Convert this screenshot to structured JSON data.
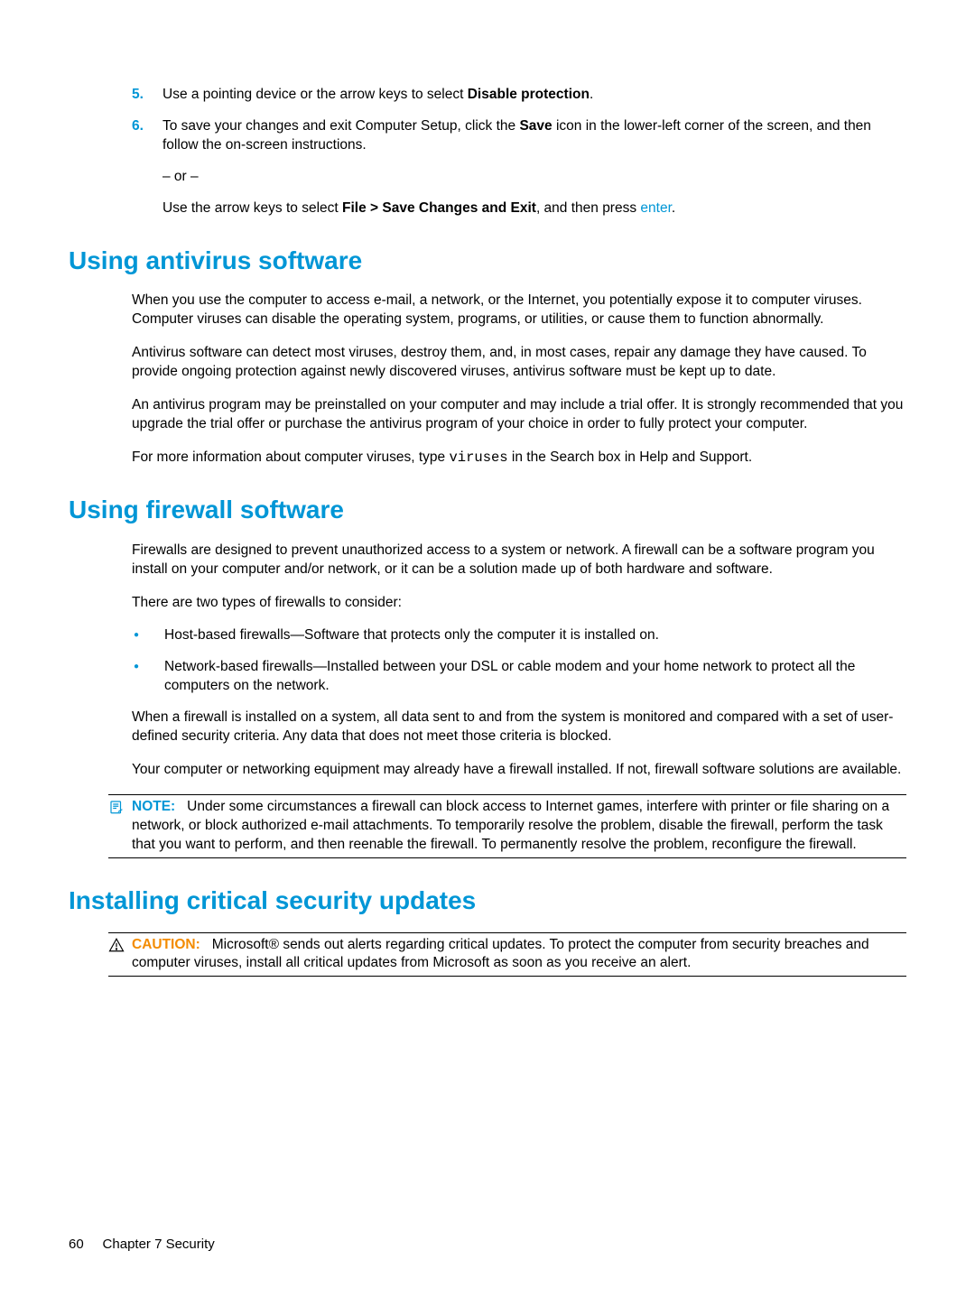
{
  "steps": {
    "s5num": "5.",
    "s5a": "Use a pointing device or the arrow keys to select ",
    "s5b": "Disable protection",
    "s5c": ".",
    "s6num": "6.",
    "s6a": "To save your changes and exit Computer Setup, click the ",
    "s6b": "Save",
    "s6c": " icon in the lower-left corner of the screen, and then follow the on-screen instructions.",
    "s6or": "– or –",
    "s6d": "Use the arrow keys to select ",
    "s6e": "File > Save Changes and Exit",
    "s6f": ", and then press ",
    "s6g": "enter",
    "s6h": "."
  },
  "av": {
    "heading": "Using antivirus software",
    "p1": "When you use the computer to access e-mail, a network, or the Internet, you potentially expose it to computer viruses. Computer viruses can disable the operating system, programs, or utilities, or cause them to function abnormally.",
    "p2": "Antivirus software can detect most viruses, destroy them, and, in most cases, repair any damage they have caused. To provide ongoing protection against newly discovered viruses, antivirus software must be kept up to date.",
    "p3": "An antivirus program may be preinstalled on your computer and may include a trial offer. It is strongly recommended that you upgrade the trial offer or purchase the antivirus program of your choice in order to fully protect your computer.",
    "p4a": "For more information about computer viruses, type ",
    "p4b": "viruses",
    "p4c": " in the Search box in Help and Support."
  },
  "fw": {
    "heading": "Using firewall software",
    "p1": "Firewalls are designed to prevent unauthorized access to a system or network. A firewall can be a software program you install on your computer and/or network, or it can be a solution made up of both hardware and software.",
    "p2": "There are two types of firewalls to consider:",
    "b1": "Host-based firewalls—Software that protects only the computer it is installed on.",
    "b2": "Network-based firewalls—Installed between your DSL or cable modem and your home network to protect all the computers on the network.",
    "p3": "When a firewall is installed on a system, all data sent to and from the system is monitored and compared with a set of user-defined security criteria. Any data that does not meet those criteria is blocked.",
    "p4": "Your computer or networking equipment may already have a firewall installed. If not, firewall software solutions are available.",
    "noteLabel": "NOTE:",
    "noteBody": "Under some circumstances a firewall can block access to Internet games, interfere with printer or file sharing on a network, or block authorized e-mail attachments. To temporarily resolve the problem, disable the firewall, perform the task that you want to perform, and then reenable the firewall. To permanently resolve the problem, reconfigure the firewall."
  },
  "upd": {
    "heading": "Installing critical security updates",
    "cautionLabel": "CAUTION:",
    "cautionBody": "Microsoft® sends out alerts regarding critical updates. To protect the computer from security breaches and computer viruses, install all critical updates from Microsoft as soon as you receive an alert."
  },
  "footer": {
    "pageNum": "60",
    "chapter": "Chapter 7   Security"
  }
}
